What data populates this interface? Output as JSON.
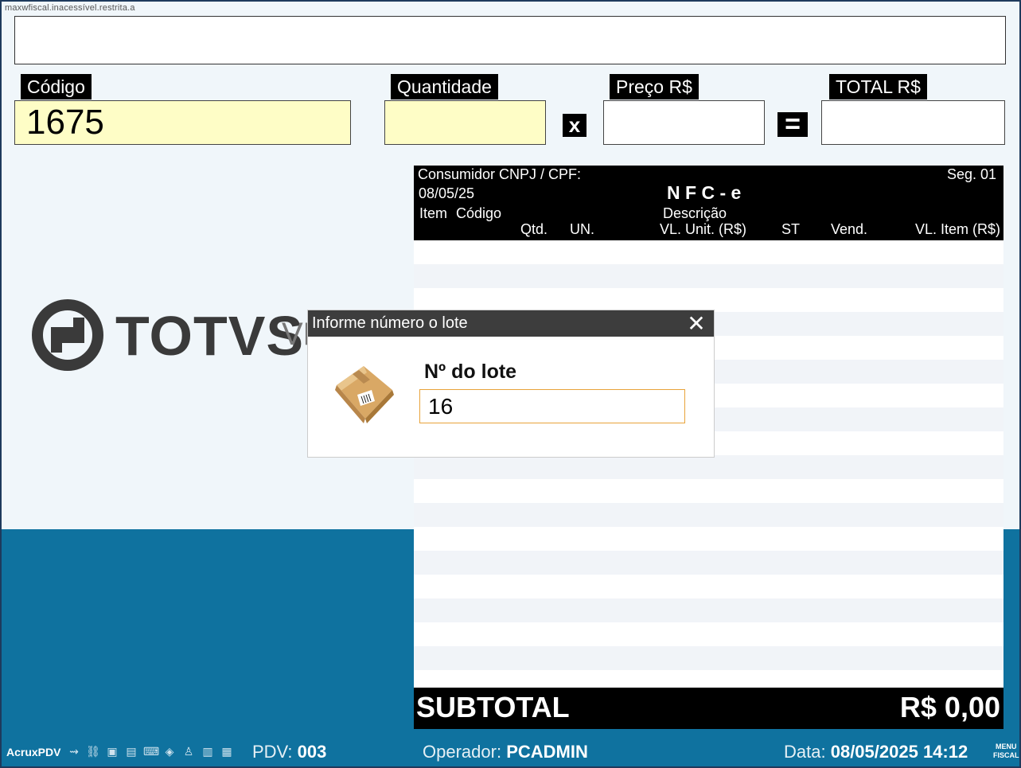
{
  "window": {
    "caption": "maxwfiscal.inacessível.restrita.a"
  },
  "fields": {
    "codigo_label": "Código",
    "codigo_value": "1675",
    "quantidade_label": "Quantidade",
    "quantidade_value": "",
    "preco_label": "Preço R$",
    "preco_value": "",
    "total_label": "TOTAL R$",
    "total_value": "",
    "times_sign": "x",
    "equals_sign": "="
  },
  "logo": {
    "text": "TOTVS",
    "suffix": "VP"
  },
  "receipt": {
    "consumidor_label": "Consumidor CNPJ / CPF:",
    "date": "08/05/25",
    "title": "N F C - e",
    "seg": "Seg. 01",
    "columns": {
      "item": "Item",
      "codigo": "Código",
      "descricao": "Descrição",
      "qtd": "Qtd.",
      "un": "UN.",
      "vl_unit": "VL. Unit. (R$)",
      "st": "ST",
      "vend": "Vend.",
      "vl_item": "VL. Item (R$)"
    },
    "subtotal_label": "SUBTOTAL",
    "subtotal_value": "R$ 0,00"
  },
  "dialog": {
    "title": "Informe número o lote",
    "close_symbol": "✕",
    "field_label": "Nº do lote",
    "field_value": "16"
  },
  "status_bar": {
    "app_name": "AcruxPDV",
    "icons": [
      "usb-icon",
      "network-icon",
      "monitor-icon",
      "printer-icon",
      "keyboard-icon",
      "scale-icon",
      "user-icon",
      "barcode-icon",
      "grid-icon"
    ],
    "pdv_label": "PDV:",
    "pdv_value": "003",
    "operador_label": "Operador:",
    "operador_value": "PCADMIN",
    "data_label": "Data:",
    "data_value": "08/05/2025 14:12",
    "menu_fiscal_line1": "MENU",
    "menu_fiscal_line2": "FISCAL"
  },
  "colors": {
    "band_blue": "#0f729f",
    "field_yellow": "#fefdc6",
    "dialog_title_bg": "#3d3d3d",
    "input_border_orange": "#e8a33a"
  }
}
